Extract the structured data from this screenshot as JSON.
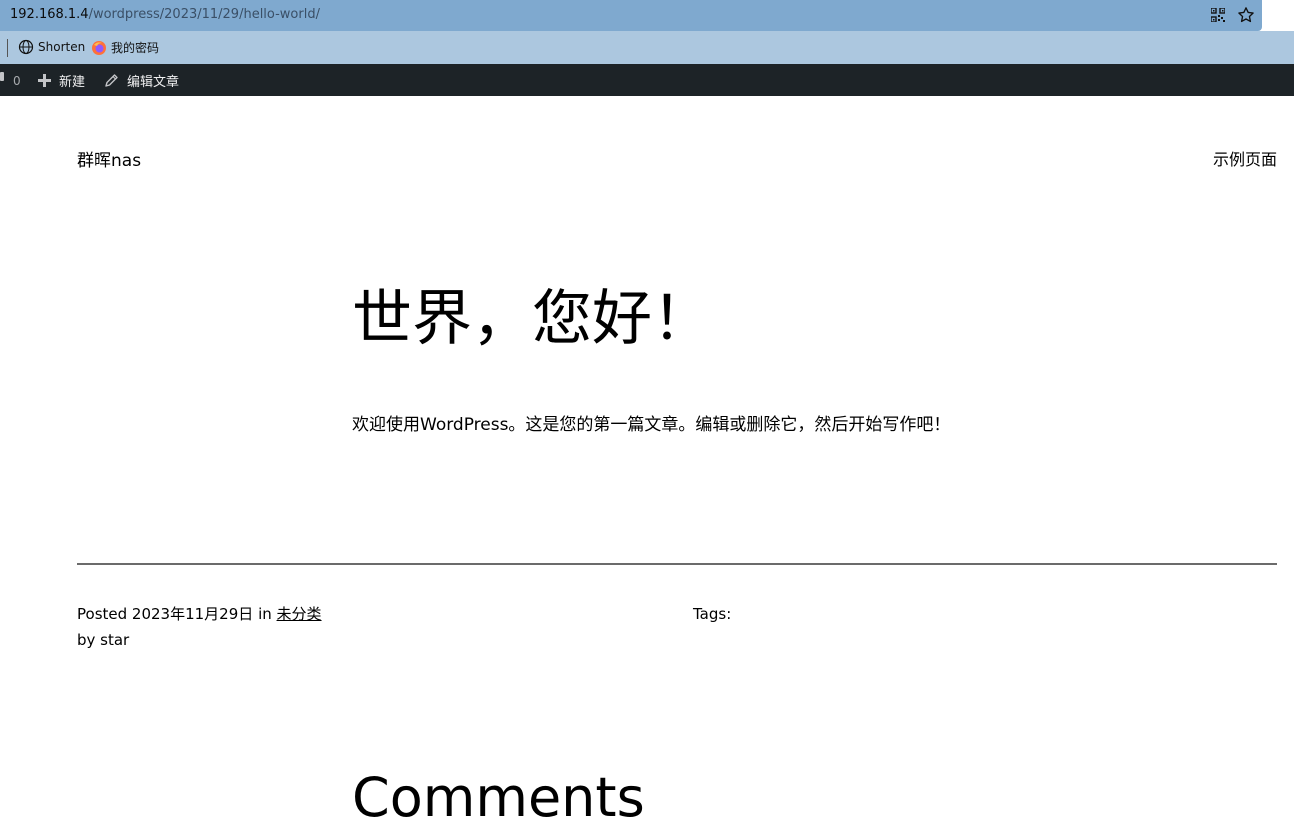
{
  "browser": {
    "url_host": "192.168.1.4",
    "url_path": "/wordpress/2023/11/29/hello-world/",
    "qr_icon": "qr-code-icon",
    "star_icon": "star-icon"
  },
  "bookmarks": {
    "items": [
      {
        "label": "Shorten",
        "icon": "globe-icon"
      },
      {
        "label": "我的密码",
        "icon": "firefox-icon"
      }
    ]
  },
  "admin_bar": {
    "comment_count": "0",
    "new_label": "新建",
    "edit_label": "编辑文章",
    "background": "#1d2327"
  },
  "site": {
    "title": "群晖nas",
    "nav_link": "示例页面"
  },
  "post": {
    "title": "世界，您好！",
    "body": "欢迎使用WordPress。这是您的第一篇文章。编辑或删除它，然后开始写作吧！",
    "posted_prefix": "Posted",
    "date": "2023年11月29日",
    "in_label": "in",
    "category": "未分类",
    "by_line": "by star",
    "tags_label": "Tags:"
  },
  "comments": {
    "heading": "Comments"
  },
  "colors": {
    "url_bar": "#7fa9cf",
    "bookmarks_bar": "#acc7df",
    "divider": "#6b6b6b"
  }
}
